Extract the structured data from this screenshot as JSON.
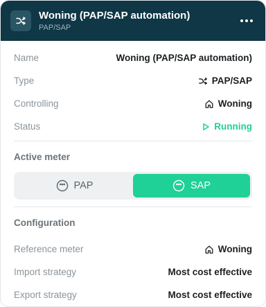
{
  "header": {
    "title": "Woning (PAP/SAP automation)",
    "subtitle": "PAP/SAP",
    "icon": "shuffle-icon",
    "menu_icon": "more-horizontal-icon"
  },
  "details": {
    "name_label": "Name",
    "name_value": "Woning (PAP/SAP automation)",
    "type_label": "Type",
    "type_value": "PAP/SAP",
    "controlling_label": "Controlling",
    "controlling_value": "Woning",
    "status_label": "Status",
    "status_value": "Running"
  },
  "active_meter": {
    "title": "Active meter",
    "options": [
      {
        "label": "PAP",
        "icon": "meter-icon",
        "active": false
      },
      {
        "label": "SAP",
        "icon": "meter-icon",
        "active": true
      }
    ]
  },
  "configuration": {
    "title": "Configuration",
    "reference_label": "Reference meter",
    "reference_value": "Woning",
    "import_label": "Import strategy",
    "import_value": "Most cost effective",
    "export_label": "Export strategy",
    "export_value": "Most cost effective"
  },
  "colors": {
    "header_bg": "#0f3745",
    "accent": "#1fd196",
    "label": "#8b949a",
    "value": "#1b1f22"
  }
}
